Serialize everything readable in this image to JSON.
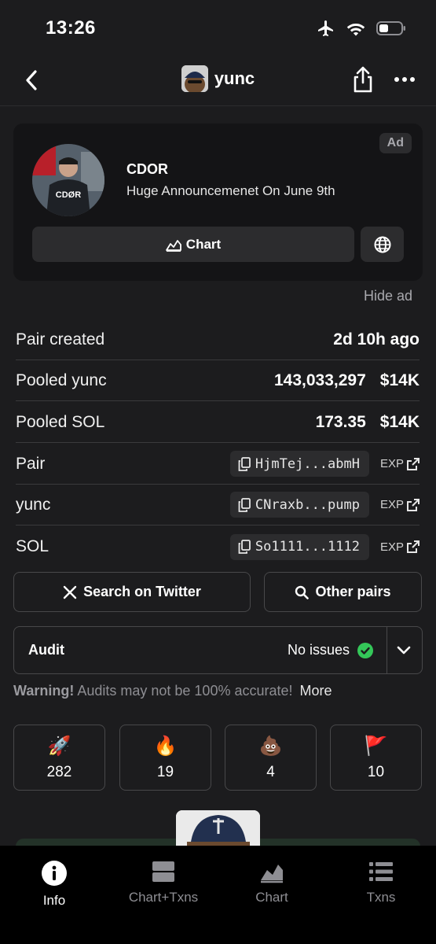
{
  "status_bar": {
    "time": "13:26"
  },
  "nav": {
    "title": "yunc"
  },
  "ad": {
    "badge": "Ad",
    "name": "CDOR",
    "description": "Huge Announcemenet On June 9th",
    "avatar_text": "CDØR",
    "chart_label": "Chart",
    "hide_label": "Hide ad"
  },
  "info": [
    {
      "label": "Pair created",
      "value": "2d 10h ago"
    },
    {
      "label": "Pooled yunc",
      "amount": "143,033,297",
      "usd": "$14K"
    },
    {
      "label": "Pooled SOL",
      "amount": "173.35",
      "usd": "$14K"
    }
  ],
  "addresses": [
    {
      "label": "Pair",
      "short": "HjmTej...abmH",
      "exp": "EXP"
    },
    {
      "label": "yunc",
      "short": "CNraxb...pump",
      "exp": "EXP"
    },
    {
      "label": "SOL",
      "short": "So1111...1112",
      "exp": "EXP"
    }
  ],
  "actions": {
    "twitter": "Search on Twitter",
    "other_pairs": "Other pairs"
  },
  "audit": {
    "label": "Audit",
    "status": "No issues",
    "warning_bold": "Warning!",
    "warning_text": "Audits may not be 100% accurate!",
    "more": "More"
  },
  "votes": [
    {
      "icon": "rocket-icon",
      "emoji": "🚀",
      "count": "282"
    },
    {
      "icon": "fire-icon",
      "emoji": "🔥",
      "count": "19"
    },
    {
      "icon": "poop-icon",
      "emoji": "💩",
      "count": "4"
    },
    {
      "icon": "flag-icon",
      "emoji": "🚩",
      "count": "10"
    }
  ],
  "tabs": [
    {
      "label": "Info",
      "active": true
    },
    {
      "label": "Chart+Txns",
      "active": false
    },
    {
      "label": "Chart",
      "active": false
    },
    {
      "label": "Txns",
      "active": false
    }
  ],
  "colors": {
    "background": "#1c1c1e",
    "card": "#141416",
    "button": "#2c2c2e",
    "success": "#34c759",
    "tab_bar": "#000000"
  }
}
